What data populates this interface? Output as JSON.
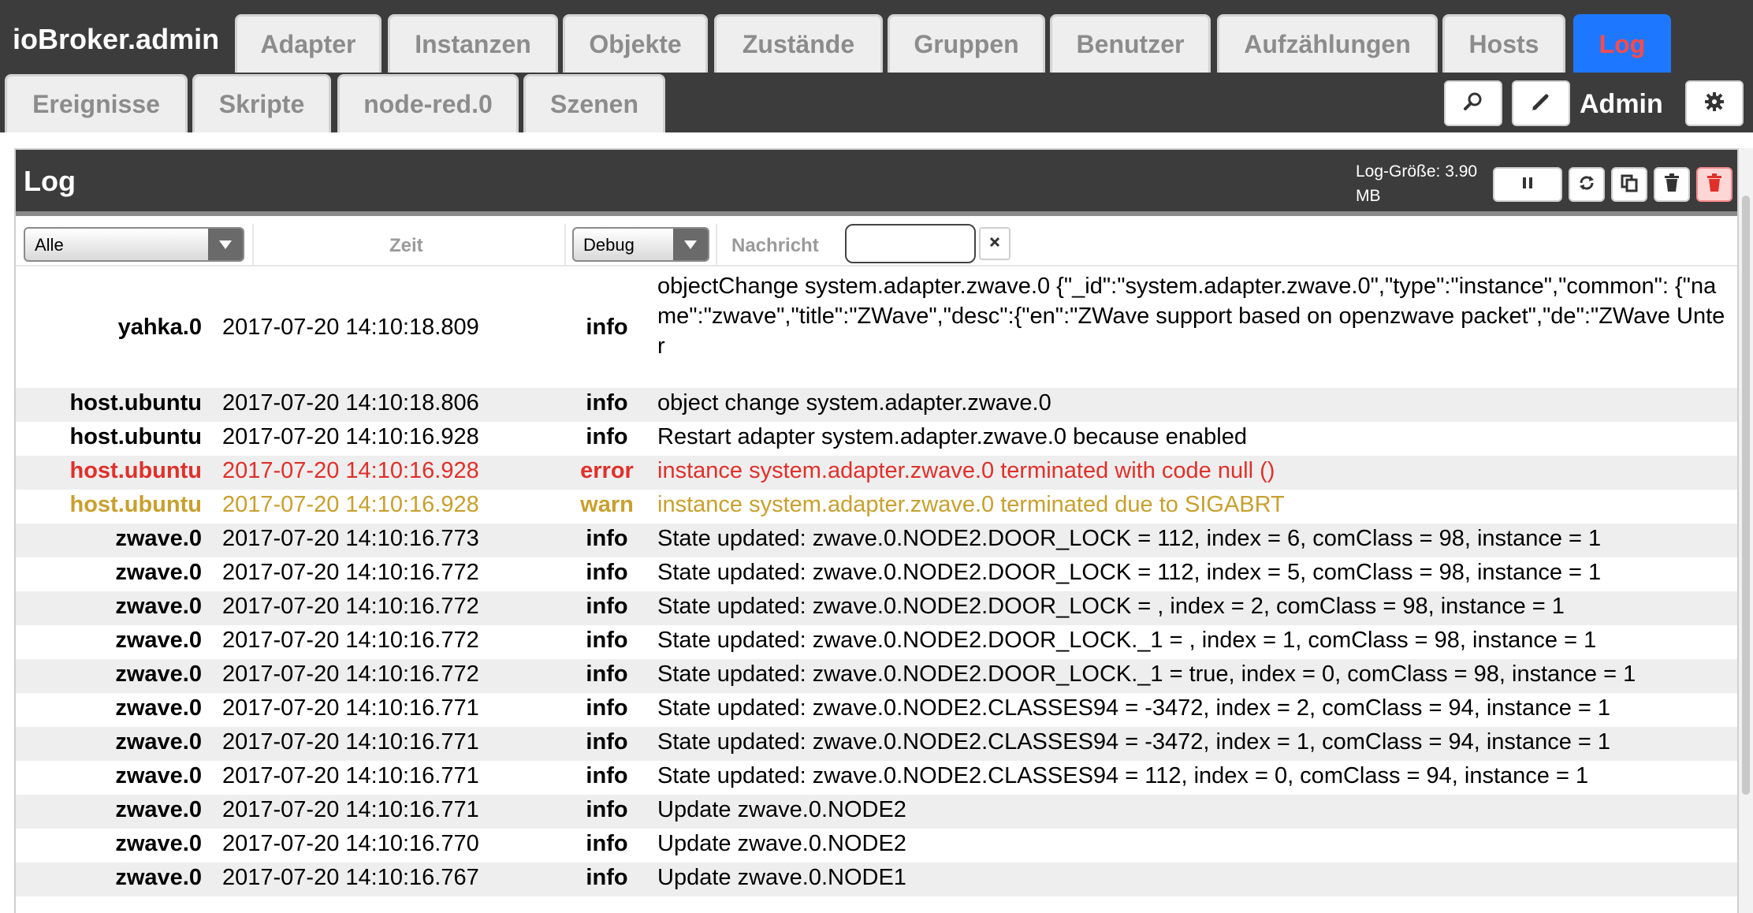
{
  "app": {
    "title": "ioBroker.admin"
  },
  "nav": {
    "row1": [
      "Adapter",
      "Instanzen",
      "Objekte",
      "Zustände",
      "Gruppen",
      "Benutzer",
      "Aufzählungen",
      "Hosts",
      "Log"
    ],
    "row2": [
      "Ereignisse",
      "Skripte",
      "node-red.0",
      "Szenen"
    ],
    "active_tab": "Log",
    "user": "Admin",
    "icons": {
      "search": "search-icon",
      "edit": "pencil-icon",
      "settings": "gear-icon"
    }
  },
  "panel": {
    "title": "Log",
    "size_label": "Log-Größe: 3.90 MB",
    "buttons": [
      "pause-icon",
      "refresh-icon",
      "copy-icon",
      "trash-icon",
      "trash-icon"
    ],
    "danger_color": "#e0302a"
  },
  "filters": {
    "source": "Alle",
    "time_label": "Zeit",
    "level": "Debug",
    "message_label": "Nachricht",
    "message_value": ""
  },
  "colors": {
    "active_tab_bg": "#1e78ff",
    "active_tab_text": "#ff4a4a",
    "error": "#e0302a",
    "warn": "#c8a02e"
  },
  "log": [
    {
      "source": "yahka.0",
      "time": "2017-07-20 14:10:18.809",
      "severity": "info",
      "message": "objectChange system.adapter.zwave.0 {\"_id\":\"system.adapter.zwave.0\",\"type\":\"instance\",\"common\": {\"name\":\"zwave\",\"title\":\"ZWave\",\"desc\":{\"en\":\"ZWave support based on openzwave packet\",\"de\":\"ZWave Unter"
    },
    {
      "source": "host.ubuntu",
      "time": "2017-07-20 14:10:18.806",
      "severity": "info",
      "message": "object change system.adapter.zwave.0"
    },
    {
      "source": "host.ubuntu",
      "time": "2017-07-20 14:10:16.928",
      "severity": "info",
      "message": "Restart adapter system.adapter.zwave.0 because enabled"
    },
    {
      "source": "host.ubuntu",
      "time": "2017-07-20 14:10:16.928",
      "severity": "error",
      "message": "instance system.adapter.zwave.0 terminated with code null ()"
    },
    {
      "source": "host.ubuntu",
      "time": "2017-07-20 14:10:16.928",
      "severity": "warn",
      "message": "instance system.adapter.zwave.0 terminated due to SIGABRT"
    },
    {
      "source": "zwave.0",
      "time": "2017-07-20 14:10:16.773",
      "severity": "info",
      "message": "State updated: zwave.0.NODE2.DOOR_LOCK = 112, index = 6, comClass = 98, instance = 1"
    },
    {
      "source": "zwave.0",
      "time": "2017-07-20 14:10:16.772",
      "severity": "info",
      "message": "State updated: zwave.0.NODE2.DOOR_LOCK = 112, index = 5, comClass = 98, instance = 1"
    },
    {
      "source": "zwave.0",
      "time": "2017-07-20 14:10:16.772",
      "severity": "info",
      "message": "State updated: zwave.0.NODE2.DOOR_LOCK = , index = 2, comClass = 98, instance = 1"
    },
    {
      "source": "zwave.0",
      "time": "2017-07-20 14:10:16.772",
      "severity": "info",
      "message": "State updated: zwave.0.NODE2.DOOR_LOCK._1 = , index = 1, comClass = 98, instance = 1"
    },
    {
      "source": "zwave.0",
      "time": "2017-07-20 14:10:16.772",
      "severity": "info",
      "message": "State updated: zwave.0.NODE2.DOOR_LOCK._1 = true, index = 0, comClass = 98, instance = 1"
    },
    {
      "source": "zwave.0",
      "time": "2017-07-20 14:10:16.771",
      "severity": "info",
      "message": "State updated: zwave.0.NODE2.CLASSES94 = -3472, index = 2, comClass = 94, instance = 1"
    },
    {
      "source": "zwave.0",
      "time": "2017-07-20 14:10:16.771",
      "severity": "info",
      "message": "State updated: zwave.0.NODE2.CLASSES94 = -3472, index = 1, comClass = 94, instance = 1"
    },
    {
      "source": "zwave.0",
      "time": "2017-07-20 14:10:16.771",
      "severity": "info",
      "message": "State updated: zwave.0.NODE2.CLASSES94 = 112, index = 0, comClass = 94, instance = 1"
    },
    {
      "source": "zwave.0",
      "time": "2017-07-20 14:10:16.771",
      "severity": "info",
      "message": "Update zwave.0.NODE2"
    },
    {
      "source": "zwave.0",
      "time": "2017-07-20 14:10:16.770",
      "severity": "info",
      "message": "Update zwave.0.NODE2"
    },
    {
      "source": "zwave.0",
      "time": "2017-07-20 14:10:16.767",
      "severity": "info",
      "message": "Update zwave.0.NODE1"
    }
  ]
}
